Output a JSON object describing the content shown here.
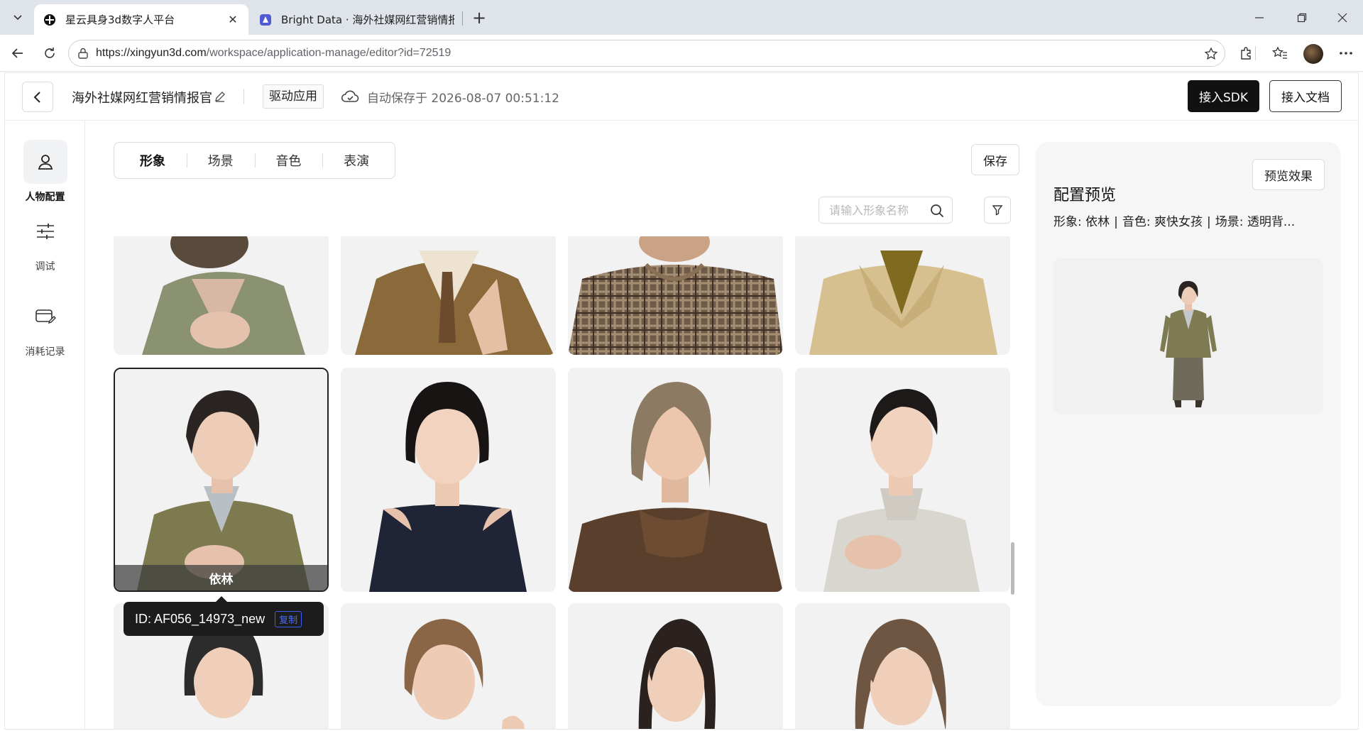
{
  "browser": {
    "tabs": [
      {
        "title": "星云具身3d数字人平台",
        "active": true
      },
      {
        "title": "Bright Data · 海外社媒网红营销情报",
        "active": false
      }
    ],
    "url_host": "https://xingyun3d.com",
    "url_path": "/workspace/application-manage/editor?id=72519"
  },
  "header": {
    "app_name": "海外社媒网红营销情报官",
    "mode": "驱动应用",
    "autosave": "自动保存于 2026-08-07 00:51:12",
    "sdk_button": "接入SDK",
    "docs_button": "接入文档"
  },
  "sidebar": {
    "items": [
      {
        "label": "人物配置",
        "icon": "person-icon",
        "active": true
      },
      {
        "label": "调试",
        "icon": "sliders-icon",
        "active": false
      },
      {
        "label": "消耗记录",
        "icon": "card-edit-icon",
        "active": false
      }
    ]
  },
  "main": {
    "tabs": [
      "形象",
      "场景",
      "音色",
      "表演"
    ],
    "active_tab": "形象",
    "save_button": "保存",
    "search_placeholder": "请输入形象名称",
    "selected_label": "依林",
    "tooltip_id": "ID: AF056_14973_new",
    "tooltip_copy": "复制"
  },
  "preview": {
    "button": "预览效果",
    "title": "配置预览",
    "info_avatar_key": "形象:",
    "info_avatar_val": "依林",
    "info_voice_key": "音色:",
    "info_voice_val": "爽快女孩",
    "info_scene_key": "场景:",
    "info_scene_val": "透明背..."
  },
  "colors": {
    "primary_button": "#111111",
    "card_bg": "#f1f1f3",
    "panel_bg": "#f6f6f7",
    "link_blue": "#4a6cf7"
  }
}
